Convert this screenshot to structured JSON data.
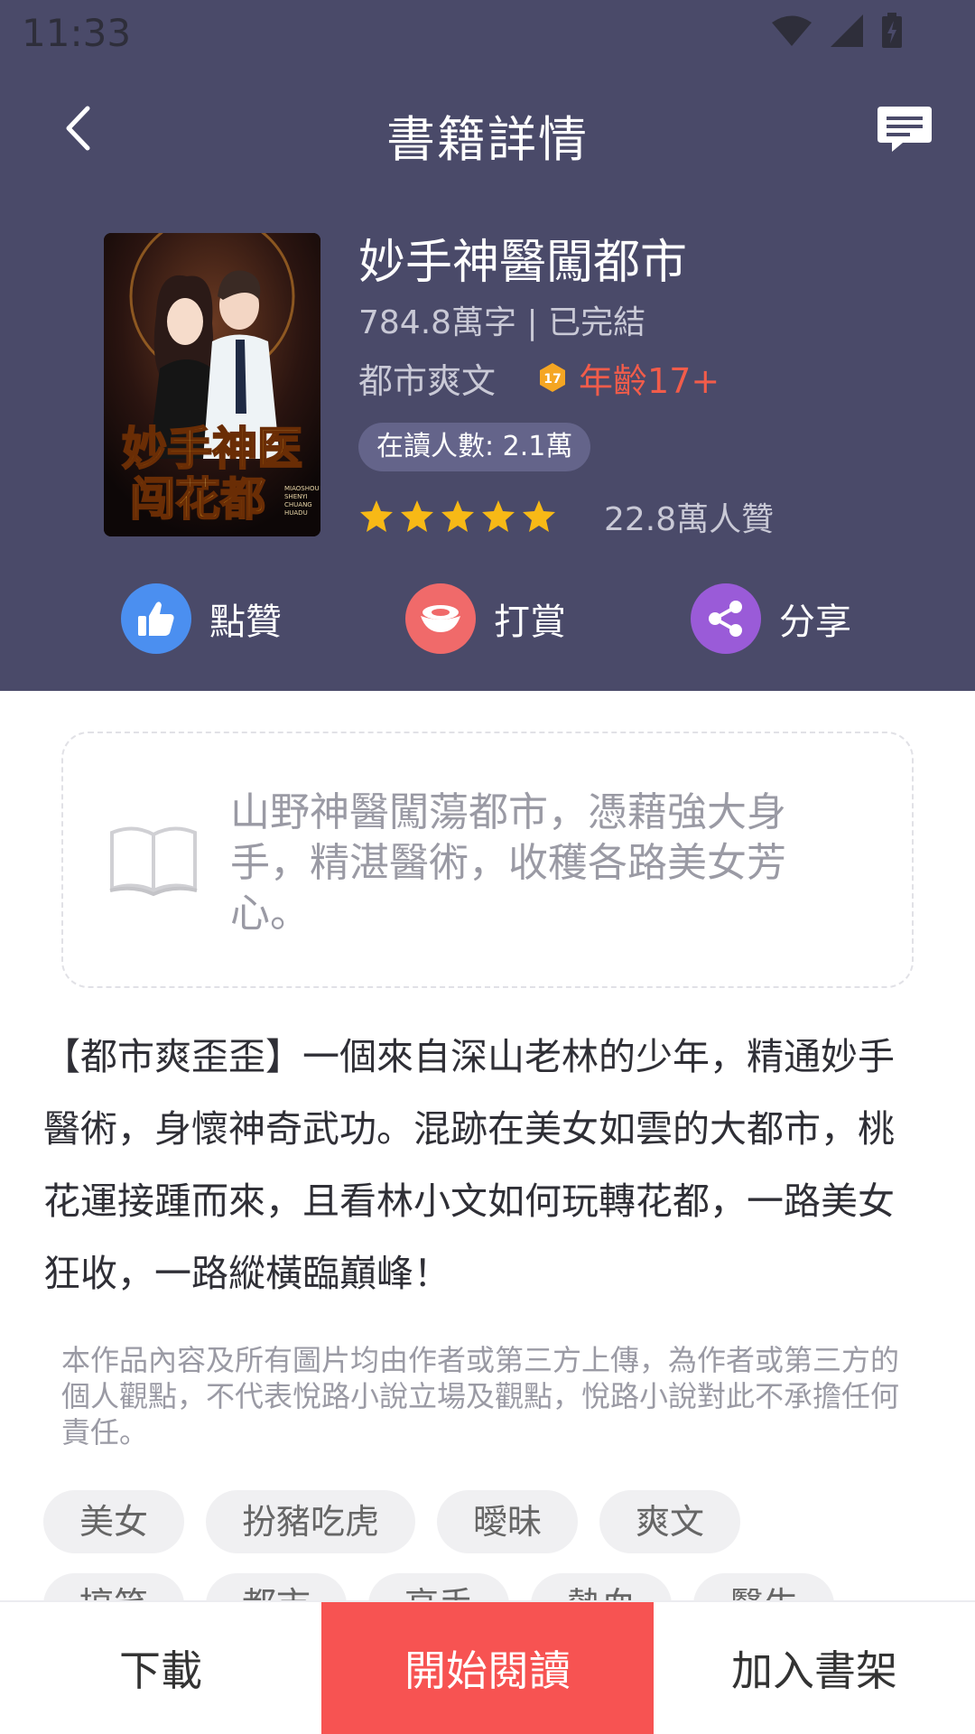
{
  "status_bar": {
    "time": "11:33"
  },
  "header": {
    "title": "書籍詳情"
  },
  "book": {
    "title": "妙手神醫闖都市",
    "meta": "784.8萬字 | 已完結",
    "genre": "都市爽文",
    "age_label": "年齡17+",
    "readers": "在讀人數: 2.1萬",
    "rating_stars": 5,
    "likes_count": "22.8萬人贊",
    "cover_art_text": "妙手神医闯花都"
  },
  "actions": [
    {
      "label": "點贊",
      "icon": "thumbs-up-icon",
      "color": "#4b8ff0"
    },
    {
      "label": "打賞",
      "icon": "ingot-icon",
      "color": "#f06a6a"
    },
    {
      "label": "分享",
      "icon": "share-icon",
      "color": "#9a5bd8"
    }
  ],
  "summary": "山野神醫闖蕩都市，憑藉強大身手，精湛醫術，收穫各路美女芳心。",
  "description": "【都市爽歪歪】一個來自深山老林的少年，精通妙手醫術，身懷神奇武功。混跡在美女如雲的大都市，桃花運接踵而來，且看林小文如何玩轉花都，一路美女狂收，一路縱橫臨巔峰！",
  "disclaimer": "本作品內容及所有圖片均由作者或第三方上傳，為作者或第三方的個人觀點，不代表悅路小說立場及觀點，悅路小說對此不承擔任何責任。",
  "tags": {
    "row1": [
      "美女",
      "扮豬吃虎",
      "曖昧",
      "爽文"
    ],
    "row2": [
      "搞笑",
      "都市",
      "高手",
      "熱血",
      "醫生"
    ]
  },
  "bottom_bar": {
    "download": "下載",
    "start_reading": "開始閱讀",
    "add_to_shelf": "加入書架"
  },
  "colors": {
    "header_bg": "#4a4a69",
    "accent_red": "#f75352",
    "age_red": "#f25c4a",
    "star_yellow": "#f7b916"
  }
}
